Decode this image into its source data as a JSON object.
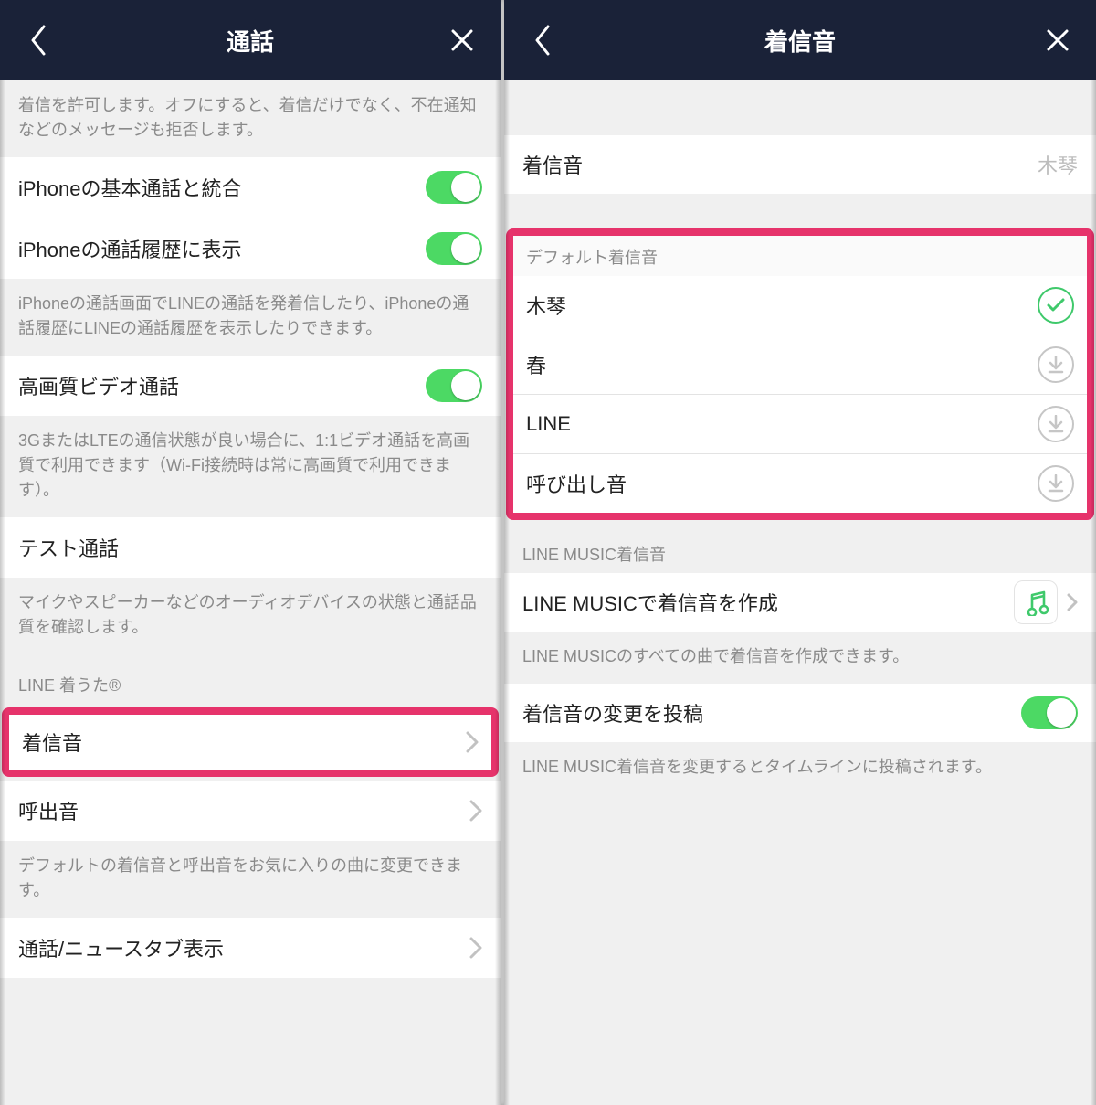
{
  "left": {
    "title": "通話",
    "note1": "着信を許可します。オフにすると、着信だけでなく、不在通知などのメッセージも拒否します。",
    "rows": {
      "integrate": "iPhoneの基本通話と統合",
      "history": "iPhoneの通話履歴に表示",
      "histNote": "iPhoneの通話画面でLINEの通話を発着信したり、iPhoneの通話履歴にLINEの通話履歴を表示したりできます。",
      "hq": "高画質ビデオ通話",
      "hqNote": "3GまたはLTEの通信状態が良い場合に、1:1ビデオ通話を高画質で利用できます（Wi-Fi接続時は常に高画質で利用できます）。",
      "test": "テスト通話",
      "testNote": "マイクやスピーカーなどのオーディオデバイスの状態と通話品質を確認します。",
      "secHead": "LINE 着うた®",
      "ring": "着信音",
      "call": "呼出音",
      "ringNote": "デフォルトの着信音と呼出音をお気に入りの曲に変更できます。",
      "tab": "通話/ニュースタブ表示"
    }
  },
  "right": {
    "title": "着信音",
    "currentLabel": "着信音",
    "currentValue": "木琴",
    "defaultHead": "デフォルト着信音",
    "items": [
      "木琴",
      "春",
      "LINE",
      "呼び出し音"
    ],
    "musicHead": "LINE MUSIC着信音",
    "createMusic": "LINE MUSICで着信音を作成",
    "musicNote": "LINE MUSICのすべての曲で着信音を作成できます。",
    "postChange": "着信音の変更を投稿",
    "postNote": "LINE MUSIC着信音を変更するとタイムラインに投稿されます。"
  }
}
